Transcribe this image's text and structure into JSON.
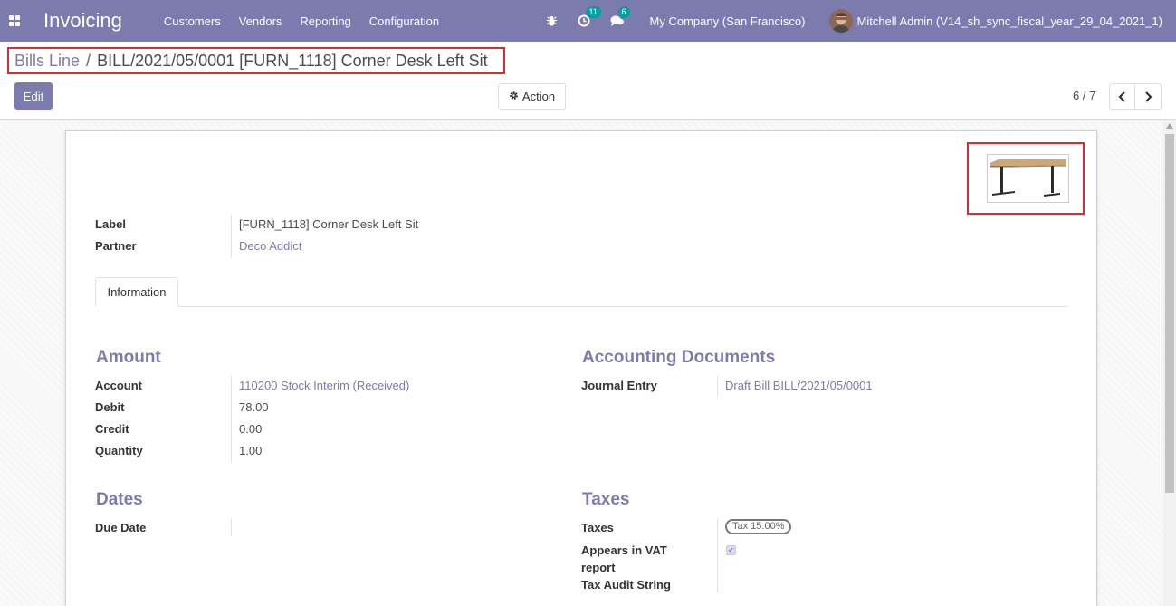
{
  "navbar": {
    "app_title": "Invoicing",
    "menu": [
      "Customers",
      "Vendors",
      "Reporting",
      "Configuration"
    ],
    "activity_badge": "11",
    "messages_badge": "6",
    "company": "My Company (San Francisco)",
    "user": "Mitchell Admin (V14_sh_sync_fiscal_year_29_04_2021_1)"
  },
  "breadcrumb": {
    "parent": "Bills Line",
    "separator": "/",
    "current": "BILL/2021/05/0001 [FURN_1118] Corner Desk Left Sit"
  },
  "toolbar": {
    "edit_label": "Edit",
    "action_label": "Action",
    "pager_value": "6 / 7"
  },
  "header_fields": {
    "label_label": "Label",
    "label_value": "[FURN_1118] Corner Desk Left Sit",
    "partner_label": "Partner",
    "partner_value": "Deco Addict"
  },
  "tabs": [
    "Information"
  ],
  "amount": {
    "title": "Amount",
    "account_label": "Account",
    "account_value": "110200 Stock Interim (Received)",
    "debit_label": "Debit",
    "debit_value": "78.00",
    "credit_label": "Credit",
    "credit_value": "0.00",
    "quantity_label": "Quantity",
    "quantity_value": "1.00"
  },
  "accounting_documents": {
    "title": "Accounting Documents",
    "journal_entry_label": "Journal Entry",
    "journal_entry_value": "Draft Bill BILL/2021/05/0001"
  },
  "dates": {
    "title": "Dates",
    "due_date_label": "Due Date",
    "due_date_value": ""
  },
  "taxes": {
    "title": "Taxes",
    "taxes_label": "Taxes",
    "tax_tag": "Tax 15.00%",
    "vat_label_line1": "Appears in VAT",
    "vat_label_line2": "report",
    "vat_checked": true,
    "audit_label": "Tax Audit String"
  },
  "colors": {
    "brand": "#7c7bad",
    "highlight_border": "#d62e2e",
    "badge": "#00a09d"
  }
}
